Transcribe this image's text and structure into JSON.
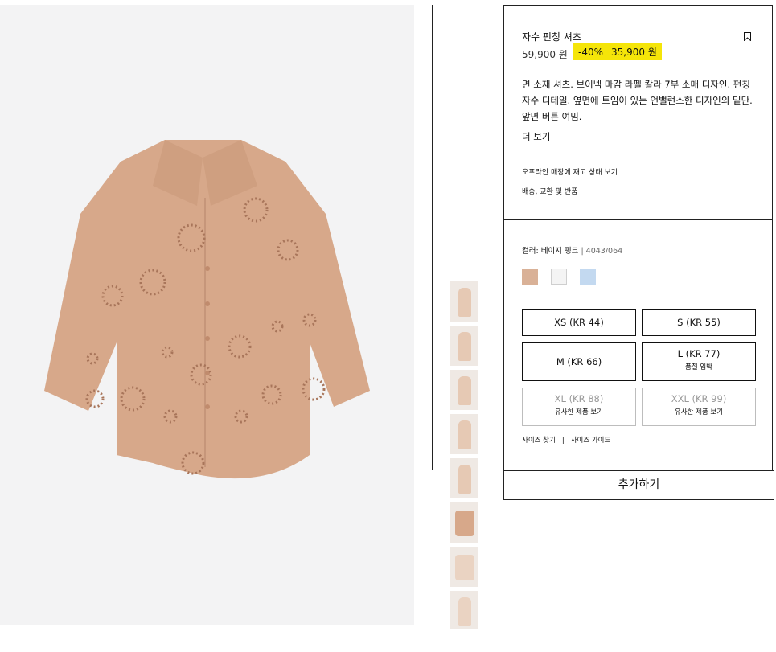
{
  "product": {
    "title": "자수 펀칭 셔츠",
    "old_price": "59,900 원",
    "discount": "-40%",
    "sale_price": "35,900 원",
    "description": "면 소재 셔츠. 브이넥 마감 라펠 칼라 7부 소매 디자인. 펀칭 자수 디테일. 옆면에 트임이 있는 언밸런스한 디자인의 밑단. 앞면 버튼 여밈.",
    "more_label": "더 보기",
    "store_stock_label": "오프라인 매장에 재고 상태 보기",
    "shipping_label": "배송, 교환 및 반품"
  },
  "color": {
    "label": "컬러: 베이지 핑크",
    "code": "| 4043/064",
    "swatches": [
      {
        "name": "beige-pink",
        "hex": "#d9b197"
      },
      {
        "name": "white",
        "hex": "#f4f4f4"
      },
      {
        "name": "light-blue",
        "hex": "#c3d9f0"
      }
    ],
    "selected_index": 0
  },
  "sizes": [
    {
      "label": "XS (KR 44)",
      "sub": "",
      "available": true
    },
    {
      "label": "S (KR 55)",
      "sub": "",
      "available": true
    },
    {
      "label": "M (KR 66)",
      "sub": "",
      "available": true
    },
    {
      "label": "L (KR 77)",
      "sub": "품절 임박",
      "available": true
    },
    {
      "label": "XL (KR 88)",
      "sub": "유사한 제품 보기",
      "available": false
    },
    {
      "label": "XXL (KR 99)",
      "sub": "유사한 제품 보기",
      "available": false
    }
  ],
  "size_links": {
    "find": "사이즈 찾기",
    "guide": "사이즈 가이드"
  },
  "add_button": "추가하기",
  "colors": {
    "sale_highlight": "#f5e509",
    "shirt": "#d7a88a",
    "photo_bg": "#f3f3f4"
  },
  "thumbnail_count": 8
}
